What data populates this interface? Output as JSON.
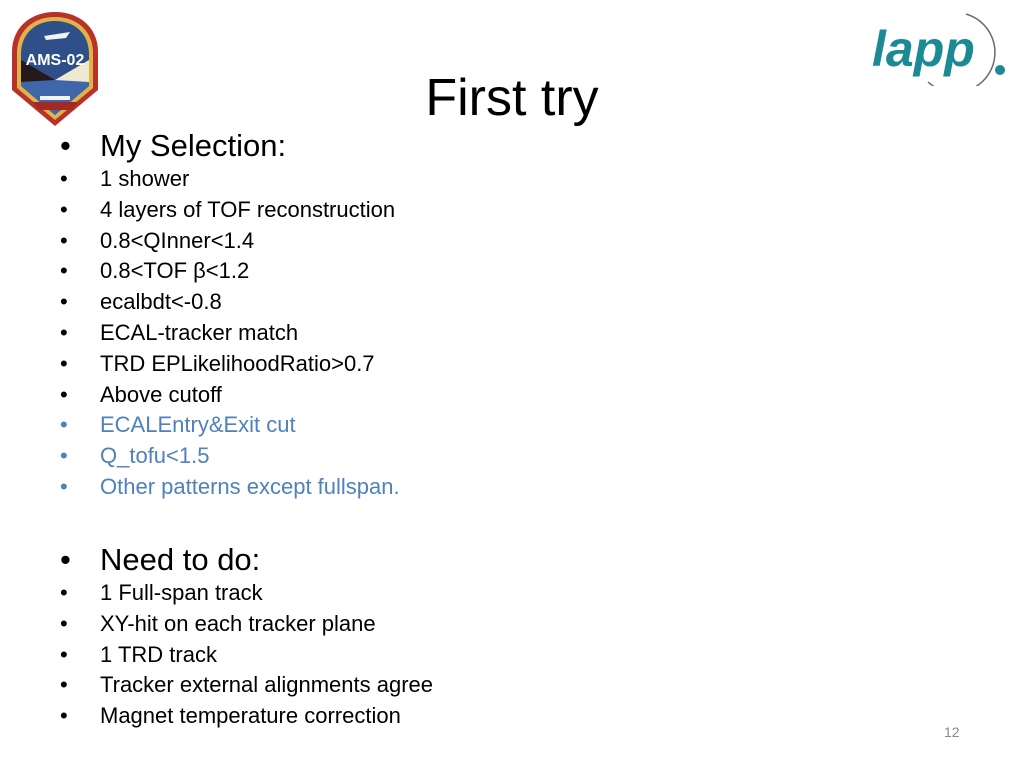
{
  "slide": {
    "title": "First try",
    "page_number": "12",
    "logos": {
      "left": {
        "name": "ams-02-mission-patch",
        "text": "AMS-02"
      },
      "right": {
        "name": "lapp-logo",
        "text": "lapp"
      }
    },
    "colors": {
      "text": "#000000",
      "highlight": "#4f81bd",
      "lapp_teal": "#1b8a94",
      "page_number": "#8a8a8a"
    },
    "selection": {
      "heading": "My Selection:",
      "items": [
        {
          "text": "1 shower",
          "highlighted": false
        },
        {
          "text": "4 layers of TOF reconstruction",
          "highlighted": false
        },
        {
          "text": "0.8<QInner<1.4",
          "highlighted": false
        },
        {
          "text": "0.8<TOF β<1.2",
          "highlighted": false
        },
        {
          "text": "ecalbdt<-0.8",
          "highlighted": false
        },
        {
          "text": "ECAL-tracker match",
          "highlighted": false
        },
        {
          "text": "TRD EPLikelihoodRatio>0.7",
          "highlighted": false
        },
        {
          "text": "Above cutoff",
          "highlighted": false
        },
        {
          "text": "ECALEntry&Exit cut",
          "highlighted": true
        },
        {
          "text": "Q_tofu<1.5",
          "highlighted": true
        },
        {
          "text": "Other patterns except fullspan.",
          "highlighted": true
        }
      ]
    },
    "todo": {
      "heading": "Need to do:",
      "items": [
        {
          "text": "1 Full-span track"
        },
        {
          "text": "XY-hit on each tracker plane"
        },
        {
          "text": "1 TRD track"
        },
        {
          "text": "Tracker external alignments agree"
        },
        {
          "text": "Magnet temperature correction"
        }
      ]
    },
    "bullet_glyph": "•"
  }
}
